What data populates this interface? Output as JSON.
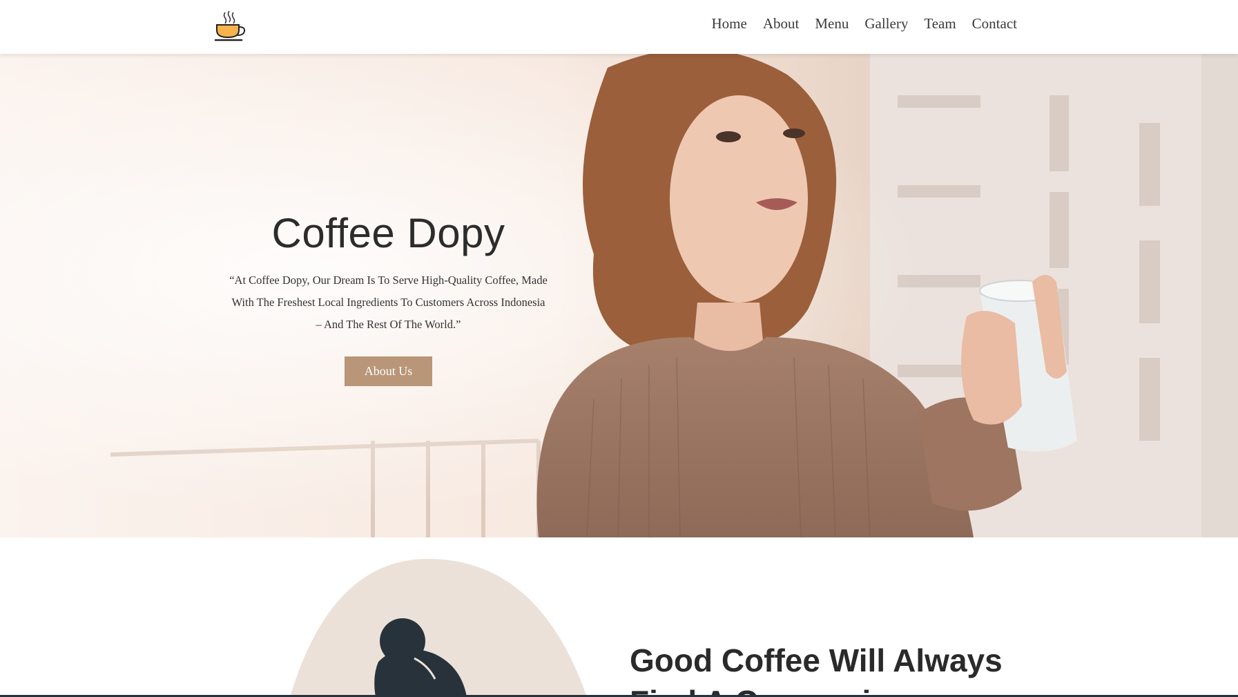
{
  "header": {
    "logo_icon": "coffee-cup-icon",
    "nav": [
      "Home",
      "About",
      "Menu",
      "Gallery",
      "Team",
      "Contact"
    ]
  },
  "hero": {
    "title": "Coffee Dopy",
    "quote_lines": [
      "“At Coffee Dopy, Our Dream Is To Serve High-Quality Coffee, Made",
      "With The Freshest Local Ingredients To Customers Across Indonesia",
      "– And The Rest Of The World.”"
    ],
    "button_label": "About Us",
    "image": "woman-holding-coffee-mug-photo"
  },
  "section2": {
    "title": "Good Coffee Will Always Find A Companion",
    "illustration": "barista-illustration"
  },
  "colors": {
    "accent": "#b89677",
    "blob": "#ebe1d8",
    "dark": "#28323a"
  }
}
